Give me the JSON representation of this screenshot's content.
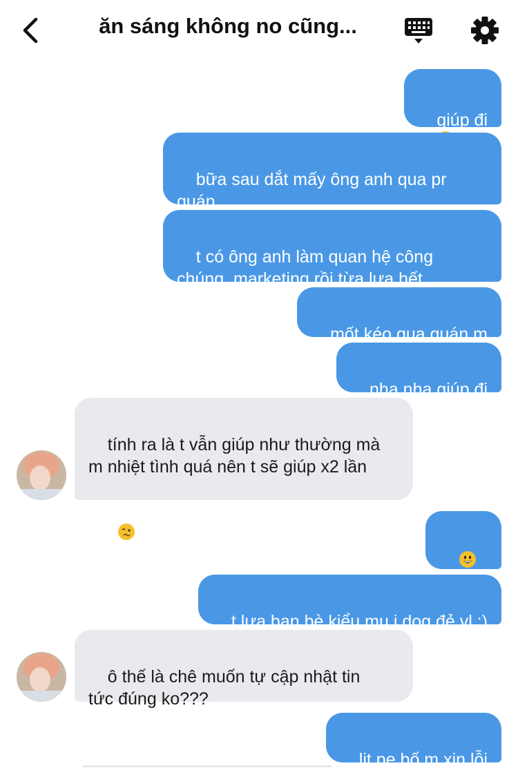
{
  "header": {
    "title": "ăn sáng không no cũng..."
  },
  "messages": [
    {
      "side": "out",
      "text": "giúp đi",
      "emojis": [
        "pleading-face-emoji",
        "pleading-face-emoji"
      ]
    },
    {
      "side": "out",
      "text": "bữa sau dắt mấy ông anh qua pr\nquán"
    },
    {
      "side": "out",
      "text": "t có ông anh làm quan hệ công\nchúng, marketing rồi từa lưa hết"
    },
    {
      "side": "out",
      "text": "mốt kéo qua quán m"
    },
    {
      "side": "out",
      "text": "nha nha giúp đi"
    },
    {
      "side": "in",
      "text": "tính ra là t vẫn giúp như thường mà\nm nhiệt tình quá nên t sẽ giúp x2 lần",
      "emojis": [
        "woozy-face-emoji"
      ]
    },
    {
      "side": "out",
      "text": "???",
      "emojis_before": [
        "grinning-face-emoji"
      ]
    },
    {
      "side": "out",
      "text": "t lựa bạn bè kiểu mu j dog đẻ vl :)"
    },
    {
      "side": "in",
      "text": "ô thế là chê muốn tự cập nhật tin\ntức đúng ko???"
    },
    {
      "side": "out",
      "text": "lịt pẹ bố m xin lỗi"
    }
  ],
  "colors": {
    "outgoing_bubble": "#4a98e5",
    "incoming_bubble": "#e8eaee"
  }
}
